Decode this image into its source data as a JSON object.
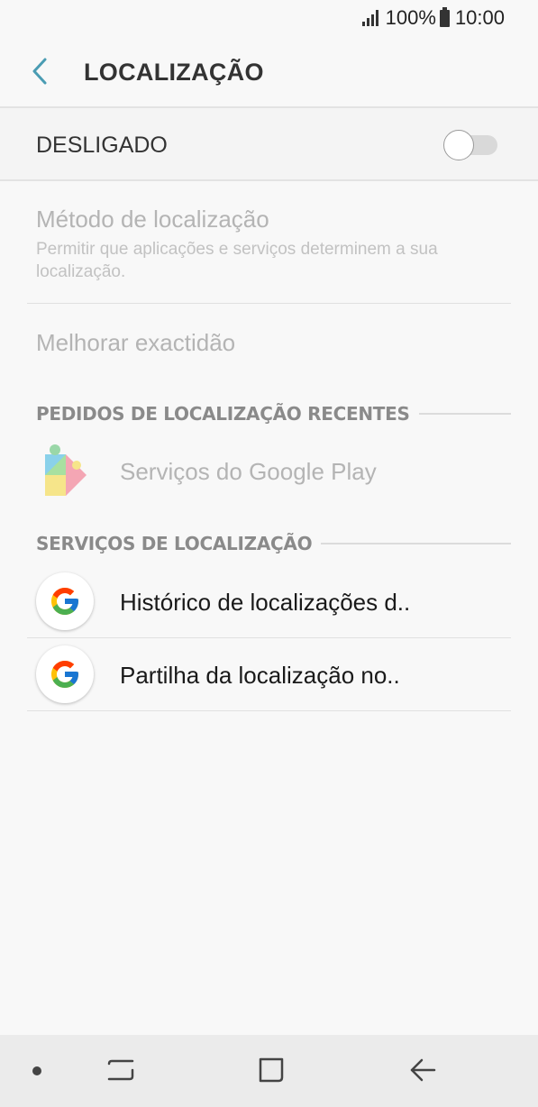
{
  "status_bar": {
    "battery_percent": "100%",
    "time": "10:00",
    "icons": [
      "signal-icon",
      "battery-icon"
    ]
  },
  "header": {
    "title": "LOCALIZAÇÃO",
    "back_icon": "chevron-left-icon",
    "accent_color": "#4a9cb3"
  },
  "master_switch": {
    "label": "DESLIGADO",
    "state": "off"
  },
  "settings": {
    "method": {
      "title": "Método de localização",
      "subtitle": "Permitir que aplicações e serviços determinem a sua localização."
    },
    "accuracy": {
      "title": "Melhorar exactidão"
    }
  },
  "recent_requests": {
    "header": "PEDIDOS DE LOCALIZAÇÃO RECENTES",
    "items": [
      {
        "label": "Serviços do Google Play",
        "icon": "google-play-services-icon"
      }
    ]
  },
  "location_services": {
    "header": "SERVIÇOS DE LOCALIZAÇÃO",
    "items": [
      {
        "label": "Histórico de localizações d..",
        "icon": "google-icon"
      },
      {
        "label": "Partilha da localização no..",
        "icon": "google-icon"
      }
    ]
  },
  "nav_bar": {
    "icons": [
      "dot-icon",
      "recents-icon",
      "home-icon",
      "back-arrow-icon"
    ]
  }
}
